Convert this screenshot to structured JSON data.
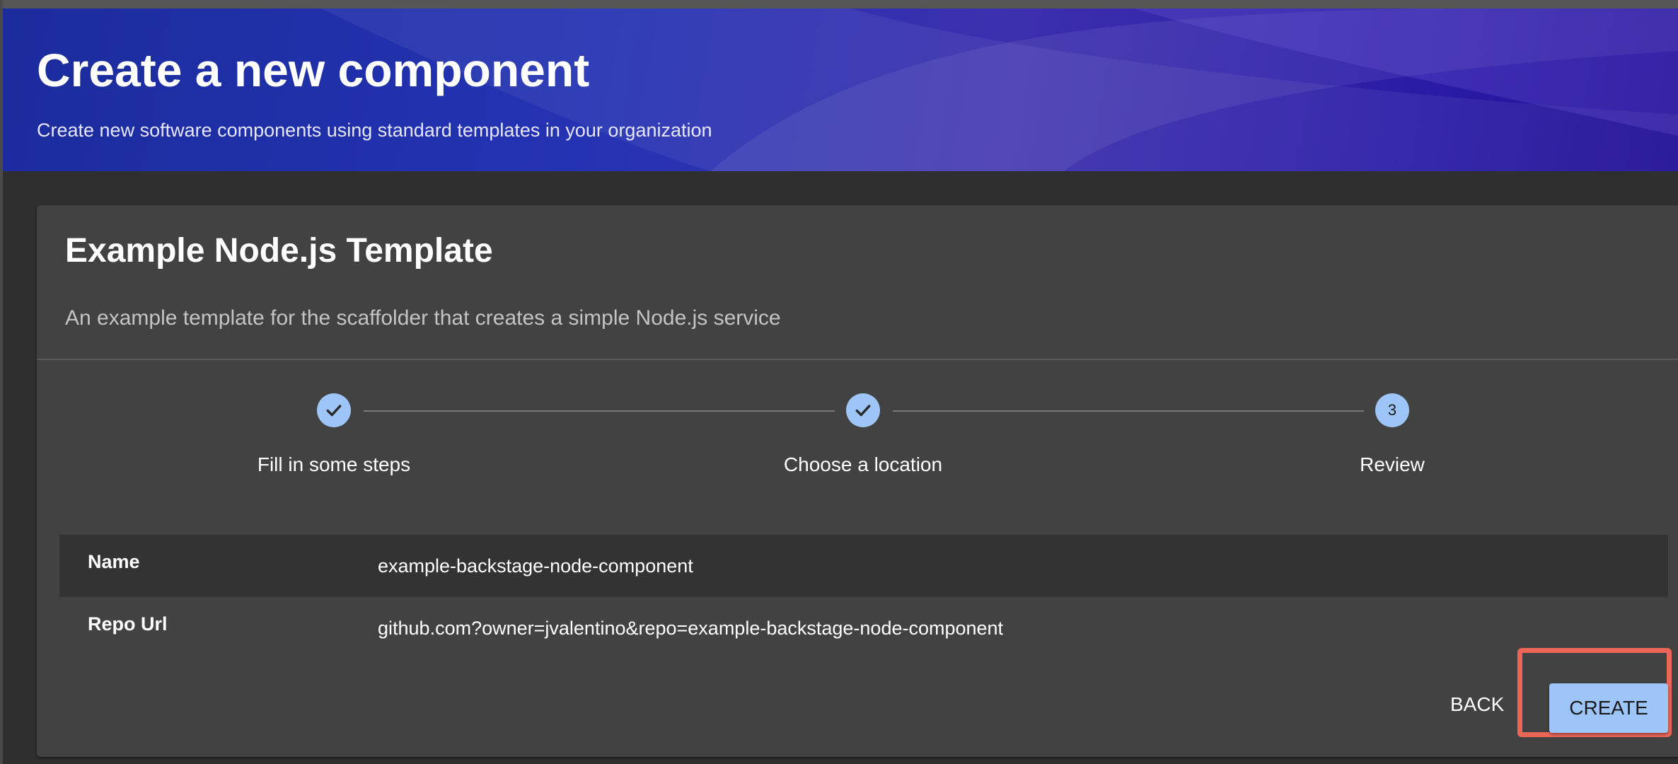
{
  "header": {
    "title": "Create a new component",
    "subtitle": "Create new software components using standard templates in your organization"
  },
  "template": {
    "title": "Example Node.js Template",
    "description": "An example template for the scaffolder that creates a simple Node.js service"
  },
  "stepper": {
    "steps": [
      {
        "label": "Fill in some steps",
        "status": "completed",
        "icon": "check-icon"
      },
      {
        "label": "Choose a location",
        "status": "completed",
        "icon": "check-icon"
      },
      {
        "label": "Review",
        "status": "active",
        "number": "3"
      }
    ]
  },
  "review": {
    "rows": [
      {
        "key": "Name",
        "value": "example-backstage-node-component"
      },
      {
        "key": "Repo Url",
        "value": "github.com?owner=jvalentino&repo=example-backstage-node-component"
      }
    ]
  },
  "actions": {
    "back_label": "BACK",
    "create_label": "CREATE"
  },
  "colors": {
    "accent": "#9ec5f8",
    "card_bg": "#424242",
    "page_bg": "#2f2f2f",
    "highlight": "#ec6658"
  }
}
